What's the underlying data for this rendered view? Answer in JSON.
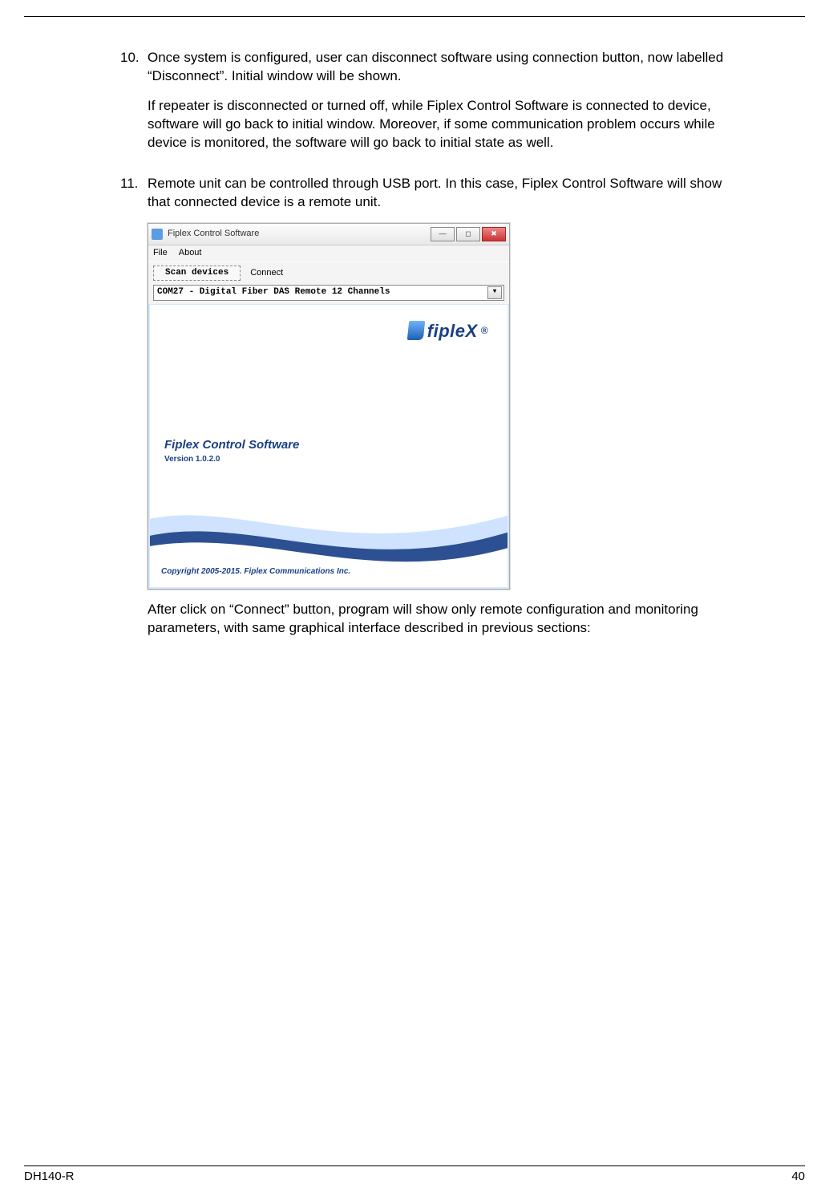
{
  "items": [
    {
      "num": "10.",
      "p1": "Once system is configured, user can disconnect software using connection button, now labelled “Disconnect”. Initial window will be shown.",
      "p2": "If repeater is disconnected or turned off, while Fiplex Control Software is connected to device, software will go back to initial window. Moreover, if some communication problem occurs while device is monitored, the software will go back to initial state as well."
    },
    {
      "num": "11.",
      "p1": "Remote unit can be controlled through USB port. In this case, Fiplex Control Software will show that connected device is a remote unit.",
      "after": "After click on “Connect” button, program will show only remote configuration and monitoring parameters, with same graphical interface described in previous sections:"
    }
  ],
  "app": {
    "title": "Fiplex Control Software",
    "menu": {
      "file": "File",
      "about": "About"
    },
    "toolbar": {
      "scan": "Scan devices",
      "connect": "Connect"
    },
    "combo": "COM27 - Digital Fiber DAS Remote 12 Channels",
    "logo_text": "fipleX",
    "logo_reg": "®",
    "sw_title": "Fiplex Control Software",
    "sw_version": "Version 1.0.2.0",
    "copyright": "Copyright 2005-2015. Fiplex Communications Inc."
  },
  "footer": {
    "left": "DH140-R",
    "right": "40"
  }
}
